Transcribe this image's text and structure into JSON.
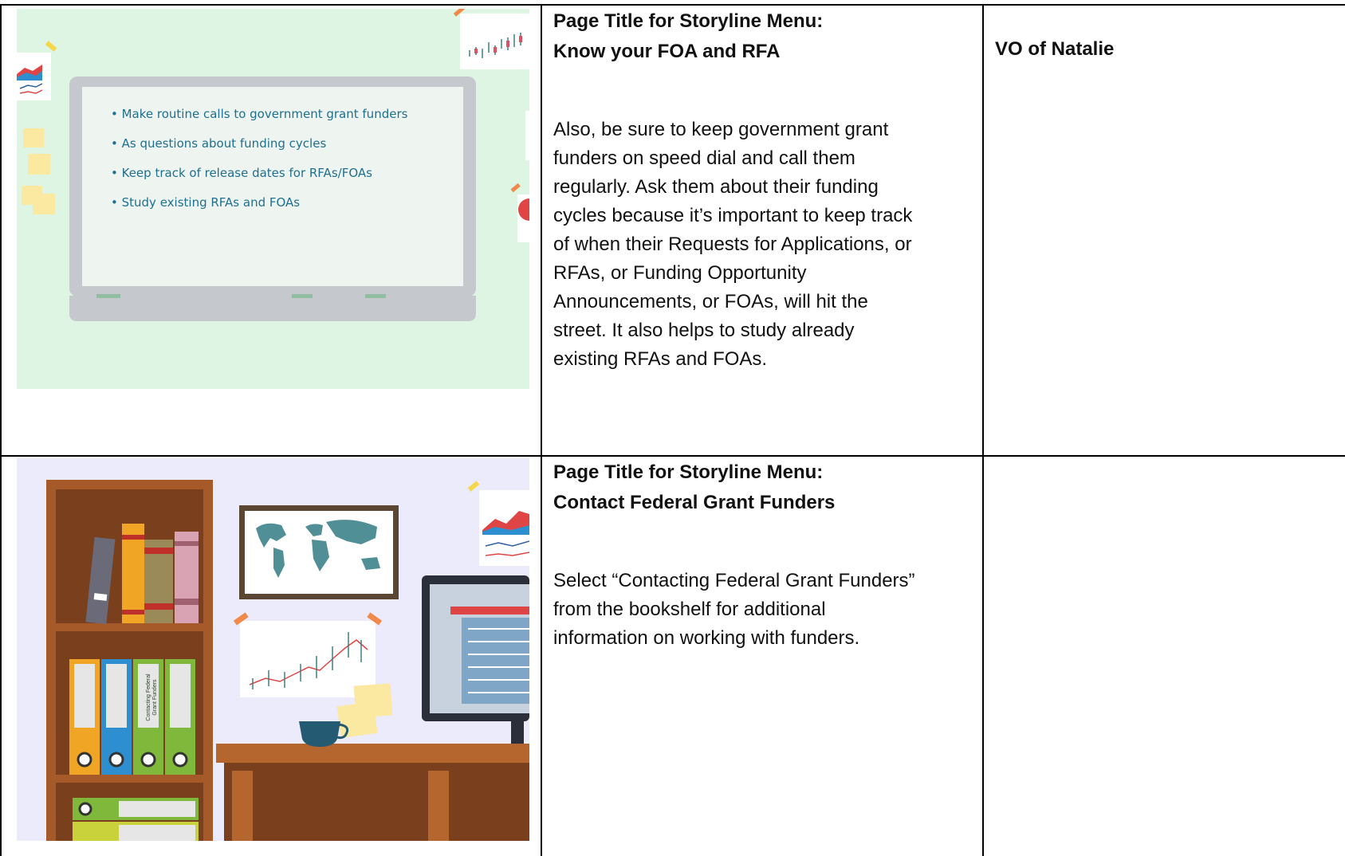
{
  "rows": [
    {
      "title_line1": "Page Title for Storyline Menu:",
      "title_line2": "Know your FOA and RFA",
      "body_lines": [
        "Also, be sure to keep government grant",
        "funders on speed dial and call them",
        "regularly.  Ask them about their funding",
        "cycles because it’s important to keep track",
        "of when their Requests for Applications, or",
        "RFAs, or Funding Opportunity",
        "Announcements, or FOAs, will hit the",
        "street. It also helps to study already",
        "existing RFAs and FOAs."
      ],
      "vo": "VO of Natalie",
      "slide_bullets": [
        "• Make routine calls to government grant funders",
        "• As questions about funding cycles",
        "• Keep track of release dates for  RFAs/FOAs",
        "• Study existing RFAs and FOAs"
      ]
    },
    {
      "title_line1": "Page Title for Storyline Menu:",
      "title_line2": "Contact Federal Grant Funders",
      "body_lines": [
        "Select “Contacting Federal Grant Funders”",
        "from the bookshelf for additional",
        "information on working with funders."
      ],
      "vo": "",
      "binder_label_line1": "Contacting Federal",
      "binder_label_line2": "Grant Funders"
    }
  ],
  "colors": {
    "slide1_bg": "#dff5e4",
    "slide2_bg": "#ebebfb",
    "board": "#c5c8cc",
    "shelf": "#a65a2a",
    "desk": "#b5652e"
  }
}
